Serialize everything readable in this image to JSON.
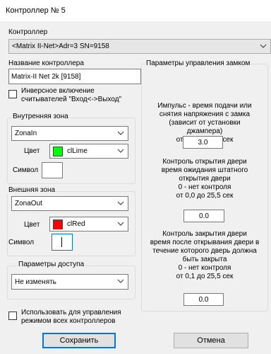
{
  "window": {
    "title": "Контроллер № 5"
  },
  "controller": {
    "section_label": "Контроллер",
    "selected": "<Matrix II-Net>Adr=3 SN=9158",
    "name_label": "Название контроллера",
    "name_value": "Matrix-II Net 2k [9158]"
  },
  "inverse": {
    "line1": "Инверсное включение",
    "line2": "считывателей \"Вход<->Выход\"",
    "checked": false
  },
  "inner_zone": {
    "title": "Внутренняя зона",
    "zone": "ZonaIn",
    "color_label": "Цвет",
    "color_name": "clLime",
    "color_hex": "#00ff00",
    "symbol_label": "Символ",
    "symbol_value": ""
  },
  "outer_zone": {
    "title": "Внешняя зона",
    "zone": "ZonaOut",
    "color_label": "Цвет",
    "color_name": "clRed",
    "color_hex": "#ff0000",
    "symbol_label": "Символ",
    "symbol_value": ""
  },
  "access": {
    "title": "Параметры доступа",
    "value": "Не изменять"
  },
  "lock": {
    "title": "Параметры управления замком",
    "impulse_lines": [
      "Импульс - время подачи или",
      "снятия напряжения с замка",
      "(зависит от установки",
      "джампера)",
      "от 0,1 до 25,5 сек"
    ],
    "impulse_value": "3.0",
    "open_lines": [
      "Контроль открытия двери",
      "время ожидания штатного",
      "открытия двери",
      "0 - нет контроля",
      "от 0,0 до 25,5 сек"
    ],
    "open_value": "0.0",
    "close_lines": [
      "Контроль закрытия двери",
      "время после открывания двери в",
      "течение которого дверь должна",
      "быть закрыта",
      "0 - нет контроля",
      "от 0,1 до 25,5 сек"
    ],
    "close_value": "0.0"
  },
  "use_all": {
    "line1": "Использовать для управления",
    "line2": "режимом всех контроллеров",
    "checked": false
  },
  "buttons": {
    "save": "Сохранить",
    "cancel": "Отмена"
  },
  "icons": {
    "chevron": "chevron-down-icon"
  }
}
